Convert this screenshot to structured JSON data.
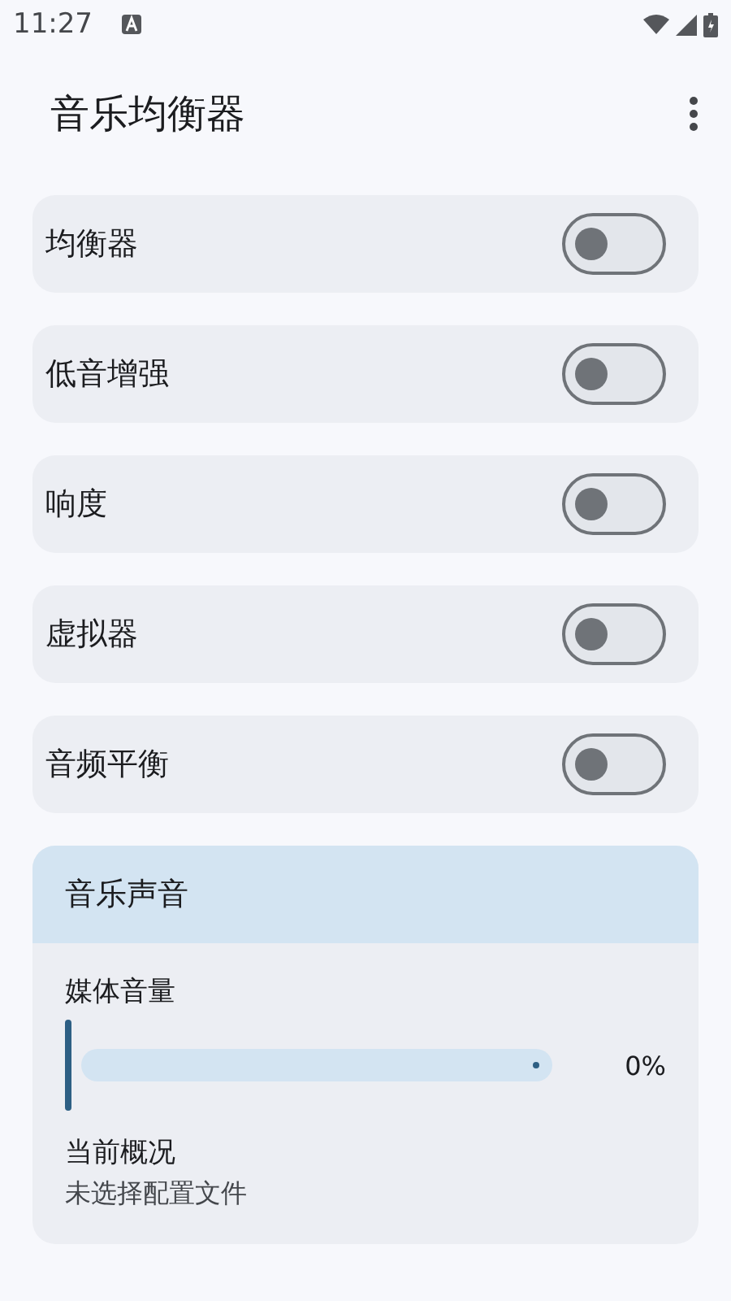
{
  "status_bar": {
    "time": "11:27"
  },
  "app_bar": {
    "title": "音乐均衡器"
  },
  "toggles": [
    {
      "label": "均衡器",
      "on": false
    },
    {
      "label": "低音增强",
      "on": false
    },
    {
      "label": "响度",
      "on": false
    },
    {
      "label": "虚拟器",
      "on": false
    },
    {
      "label": "音频平衡",
      "on": false
    }
  ],
  "music_sound": {
    "title": "音乐声音",
    "slider": {
      "label": "媒体音量",
      "level": 0,
      "reading": "0%"
    },
    "profile": {
      "label": "当前概况",
      "value": "未选择配置文件"
    }
  }
}
